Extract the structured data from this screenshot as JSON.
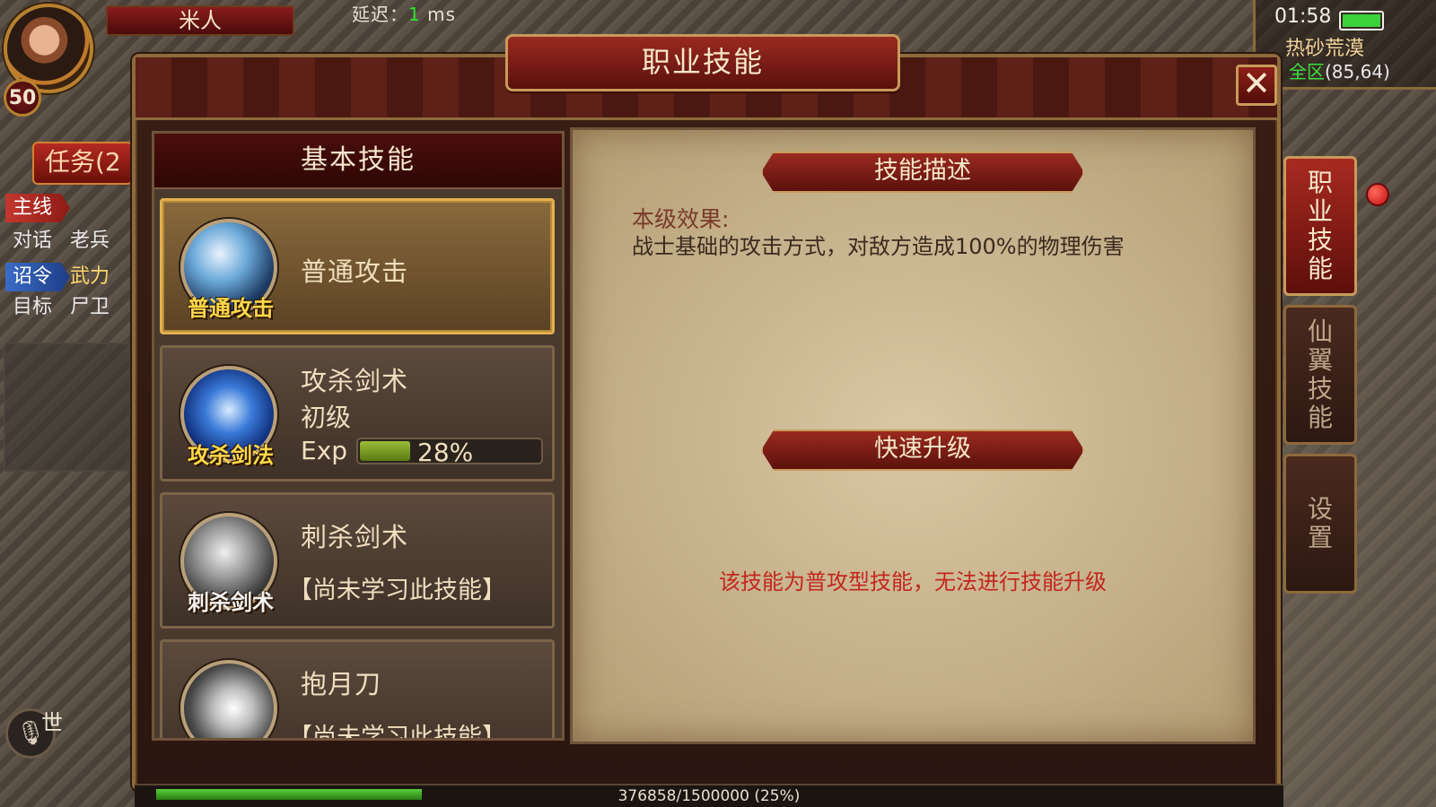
{
  "hud": {
    "player_name": "米人",
    "level": "50",
    "latency_prefix": "延迟：",
    "latency_value": "1",
    "latency_unit": "ms"
  },
  "quest": {
    "button": "任务(2",
    "rows": [
      {
        "tag": "主线",
        "tag_style": "red",
        "text": ""
      },
      {
        "tag": "对话",
        "tag_style": "plain",
        "text": "老兵"
      },
      {
        "tag": "诏令",
        "tag_style": "blue",
        "text": "武力"
      },
      {
        "tag": "目标",
        "tag_style": "plain",
        "text": "尸卫"
      }
    ]
  },
  "status": {
    "time": "01:58",
    "map": "热砂荒漠",
    "coords_prefix": "全区",
    "coords": "(85,64)",
    "battery_level": 1.0
  },
  "window": {
    "title": "职业技能",
    "close_label": "✕"
  },
  "list": {
    "header": "基本技能",
    "skills": [
      {
        "icon_label": "普通攻击",
        "name": "普通攻击",
        "selected": true
      },
      {
        "icon_label": "攻杀剑法",
        "name": "攻杀剑术",
        "rank": "初级",
        "exp_label": "Exp",
        "exp_pct": "28%",
        "exp_fraction": 0.28
      },
      {
        "icon_label": "刺杀剑术",
        "name": "刺杀剑术",
        "status": "【尚未学习此技能】"
      },
      {
        "icon_label": "",
        "name": "抱月刀",
        "status": "【尚未学习此技能】"
      }
    ]
  },
  "detail": {
    "desc_heading": "技能描述",
    "effect_label": "本级效果:",
    "effect_text": "战士基础的攻击方式，对敌方造成100%的物理伤害",
    "upgrade_heading": "快速升级",
    "upgrade_note": "该技能为普攻型技能，无法进行技能升级"
  },
  "tabs": [
    {
      "label": "职业技能",
      "active": true
    },
    {
      "label": "仙翼技能",
      "active": false
    },
    {
      "label": "设置",
      "active": false
    }
  ],
  "exp": {
    "text": "376858/1500000 (25%)",
    "fraction": 0.25
  },
  "chat": {
    "channel": "世"
  },
  "colors": {
    "accent_red": "#9a2a20",
    "gold": "#c89a5a",
    "warning": "#c3261e"
  }
}
